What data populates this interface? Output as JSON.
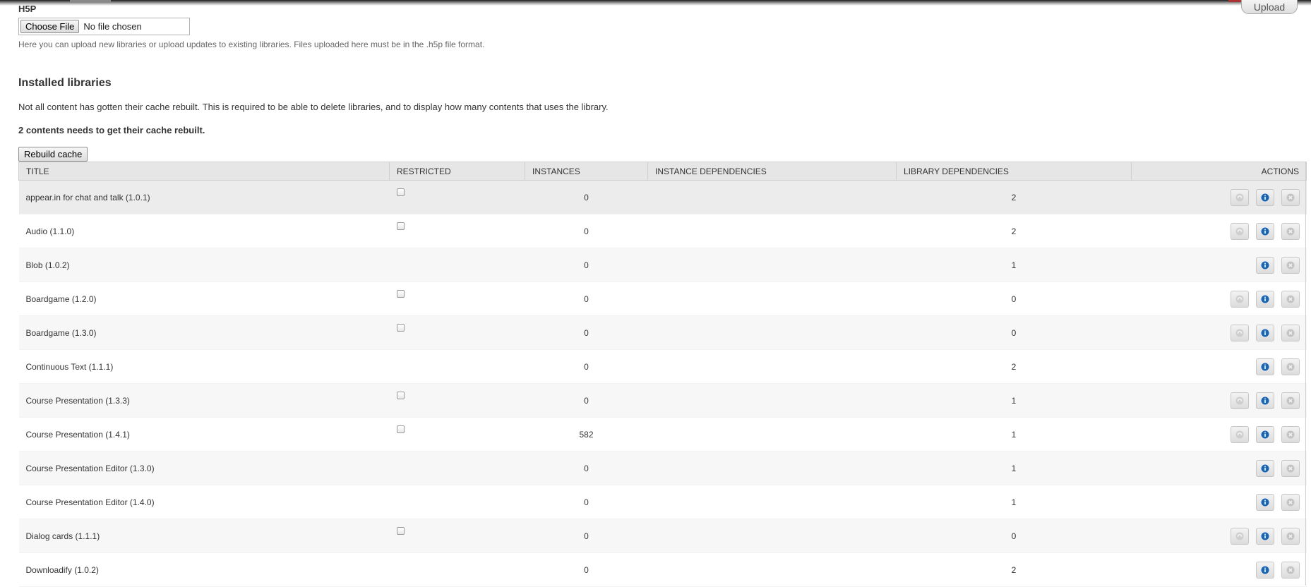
{
  "header": {
    "upload_label": "Upload"
  },
  "upload_section": {
    "label": "H5P",
    "choose_file_label": "Choose File",
    "file_status": "No file chosen",
    "help_text": "Here you can upload new libraries or upload updates to existing libraries. Files uploaded here must be in the .h5p file format."
  },
  "installed": {
    "title": "Installed libraries",
    "notice": "Not all content has gotten their cache rebuilt. This is required to be able to delete libraries, and to display how many contents that uses the library.",
    "needs_rebuild": "2 contents needs to get their cache rebuilt.",
    "rebuild_label": "Rebuild cache"
  },
  "table": {
    "columns": [
      "TITLE",
      "RESTRICTED",
      "INSTANCES",
      "INSTANCE DEPENDENCIES",
      "LIBRARY DEPENDENCIES",
      "ACTIONS"
    ],
    "rows": [
      {
        "title": "appear.in for chat and talk (1.0.1)",
        "restricted_checkbox": true,
        "instances": "0",
        "instance_dependencies": "",
        "library_dependencies": "2",
        "upgrade_button": true
      },
      {
        "title": "Audio (1.1.0)",
        "restricted_checkbox": true,
        "instances": "0",
        "instance_dependencies": "",
        "library_dependencies": "2",
        "upgrade_button": true
      },
      {
        "title": "Blob (1.0.2)",
        "restricted_checkbox": false,
        "instances": "0",
        "instance_dependencies": "",
        "library_dependencies": "1",
        "upgrade_button": false
      },
      {
        "title": "Boardgame (1.2.0)",
        "restricted_checkbox": true,
        "instances": "0",
        "instance_dependencies": "",
        "library_dependencies": "0",
        "upgrade_button": true
      },
      {
        "title": "Boardgame (1.3.0)",
        "restricted_checkbox": true,
        "instances": "0",
        "instance_dependencies": "",
        "library_dependencies": "0",
        "upgrade_button": true
      },
      {
        "title": "Continuous Text (1.1.1)",
        "restricted_checkbox": false,
        "instances": "0",
        "instance_dependencies": "",
        "library_dependencies": "2",
        "upgrade_button": false
      },
      {
        "title": "Course Presentation (1.3.3)",
        "restricted_checkbox": true,
        "instances": "0",
        "instance_dependencies": "",
        "library_dependencies": "1",
        "upgrade_button": true
      },
      {
        "title": "Course Presentation (1.4.1)",
        "restricted_checkbox": true,
        "instances": "582",
        "instance_dependencies": "",
        "library_dependencies": "1",
        "upgrade_button": true
      },
      {
        "title": "Course Presentation Editor (1.3.0)",
        "restricted_checkbox": false,
        "instances": "0",
        "instance_dependencies": "",
        "library_dependencies": "1",
        "upgrade_button": false
      },
      {
        "title": "Course Presentation Editor (1.4.0)",
        "restricted_checkbox": false,
        "instances": "0",
        "instance_dependencies": "",
        "library_dependencies": "1",
        "upgrade_button": false
      },
      {
        "title": "Dialog cards (1.1.1)",
        "restricted_checkbox": true,
        "instances": "0",
        "instance_dependencies": "",
        "library_dependencies": "0",
        "upgrade_button": true
      },
      {
        "title": "Downloadify (1.0.2)",
        "restricted_checkbox": false,
        "instances": "0",
        "instance_dependencies": "",
        "library_dependencies": "2",
        "upgrade_button": false
      }
    ]
  },
  "icons": {
    "upgrade": "upgrade-icon",
    "details": "info-icon",
    "delete": "delete-icon"
  },
  "colors": {
    "info_icon": "#1a66b5",
    "disabled_icon": "#c4c4c4",
    "header_bg": "#e6e6e6"
  }
}
